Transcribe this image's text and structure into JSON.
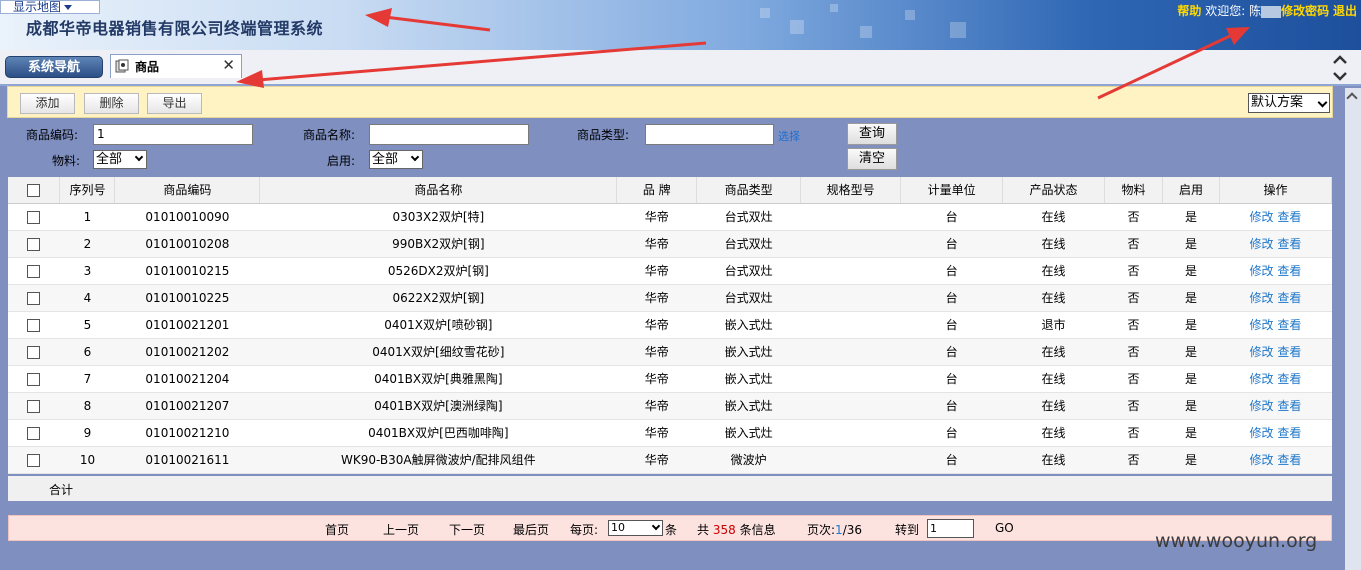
{
  "header": {
    "map_toggle": "显示地图",
    "system_title": "成都华帝电器销售有限公司终端管理系统",
    "help_link": "帮助",
    "welcome_text": "欢迎您:",
    "user_name": "陈",
    "change_password_link": "修改密码",
    "logout_link": "退出"
  },
  "tabs": {
    "nav_button": "系统导航",
    "active_tab": "商品",
    "close_glyph": "✕"
  },
  "toolbar": {
    "add_label": "添加",
    "delete_label": "删除",
    "export_label": "导出",
    "scheme_value": "默认方案"
  },
  "search": {
    "code_label": "商品编码:",
    "code_value": "1",
    "name_label": "商品名称:",
    "name_value": "",
    "type_label": "商品类型:",
    "type_value": "",
    "pick_link": "选择",
    "material_label": "物料:",
    "material_value": "全部",
    "enabled_label": "启用:",
    "enabled_value": "全部",
    "query_button": "查询",
    "clear_button": "清空"
  },
  "table": {
    "columns": [
      "序列号",
      "商品编码",
      "商品名称",
      "品  牌",
      "商品类型",
      "规格型号",
      "计量单位",
      "产品状态",
      "物料",
      "启用",
      "操作"
    ],
    "edit_link": "修改",
    "view_link": "查看",
    "rows": [
      {
        "seq": "1",
        "code": "01010010090",
        "name": "0303X2双炉[特]",
        "brand": "华帝",
        "type": "台式双灶",
        "spec": "",
        "unit": "台",
        "status": "在线",
        "material": "否",
        "enabled": "是"
      },
      {
        "seq": "2",
        "code": "01010010208",
        "name": "990BX2双炉[钢]",
        "brand": "华帝",
        "type": "台式双灶",
        "spec": "",
        "unit": "台",
        "status": "在线",
        "material": "否",
        "enabled": "是"
      },
      {
        "seq": "3",
        "code": "01010010215",
        "name": "0526DX2双炉[钢]",
        "brand": "华帝",
        "type": "台式双灶",
        "spec": "",
        "unit": "台",
        "status": "在线",
        "material": "否",
        "enabled": "是"
      },
      {
        "seq": "4",
        "code": "01010010225",
        "name": "0622X2双炉[钢]",
        "brand": "华帝",
        "type": "台式双灶",
        "spec": "",
        "unit": "台",
        "status": "在线",
        "material": "否",
        "enabled": "是"
      },
      {
        "seq": "5",
        "code": "01010021201",
        "name": "0401X双炉[喷砂钢]",
        "brand": "华帝",
        "type": "嵌入式灶",
        "spec": "",
        "unit": "台",
        "status": "退市",
        "material": "否",
        "enabled": "是"
      },
      {
        "seq": "6",
        "code": "01010021202",
        "name": "0401X双炉[细纹雪花砂]",
        "brand": "华帝",
        "type": "嵌入式灶",
        "spec": "",
        "unit": "台",
        "status": "在线",
        "material": "否",
        "enabled": "是"
      },
      {
        "seq": "7",
        "code": "01010021204",
        "name": "0401BX双炉[典雅黑陶]",
        "brand": "华帝",
        "type": "嵌入式灶",
        "spec": "",
        "unit": "台",
        "status": "在线",
        "material": "否",
        "enabled": "是"
      },
      {
        "seq": "8",
        "code": "01010021207",
        "name": "0401BX双炉[澳洲绿陶]",
        "brand": "华帝",
        "type": "嵌入式灶",
        "spec": "",
        "unit": "台",
        "status": "在线",
        "material": "否",
        "enabled": "是"
      },
      {
        "seq": "9",
        "code": "01010021210",
        "name": "0401BX双炉[巴西咖啡陶]",
        "brand": "华帝",
        "type": "嵌入式灶",
        "spec": "",
        "unit": "台",
        "status": "在线",
        "material": "否",
        "enabled": "是"
      },
      {
        "seq": "10",
        "code": "01010021611",
        "name": "WK90-B30A触屏微波炉/配排风组件",
        "brand": "华帝",
        "type": "微波炉",
        "spec": "",
        "unit": "台",
        "status": "在线",
        "material": "否",
        "enabled": "是"
      }
    ],
    "total_label": "合计"
  },
  "pager": {
    "first": "首页",
    "prev": "上一页",
    "next": "下一页",
    "last": "最后页",
    "per_page_label": "每页:",
    "per_page_value": "10",
    "per_page_unit": "条",
    "total_prefix": "共",
    "total_count": "358",
    "total_suffix": "条信息",
    "page_label": "页次:",
    "current_page": "1",
    "total_pages": "/36",
    "goto_label": "转到",
    "goto_value": "1",
    "go_button": "GO"
  },
  "watermark": "www.wooyun.org",
  "colors": {
    "toolbar_bg": "#fff3c4",
    "pager_bg": "#fde3e0",
    "link": "#1f77c9",
    "header_link": "#ffd700",
    "annotation": "#e53935"
  }
}
